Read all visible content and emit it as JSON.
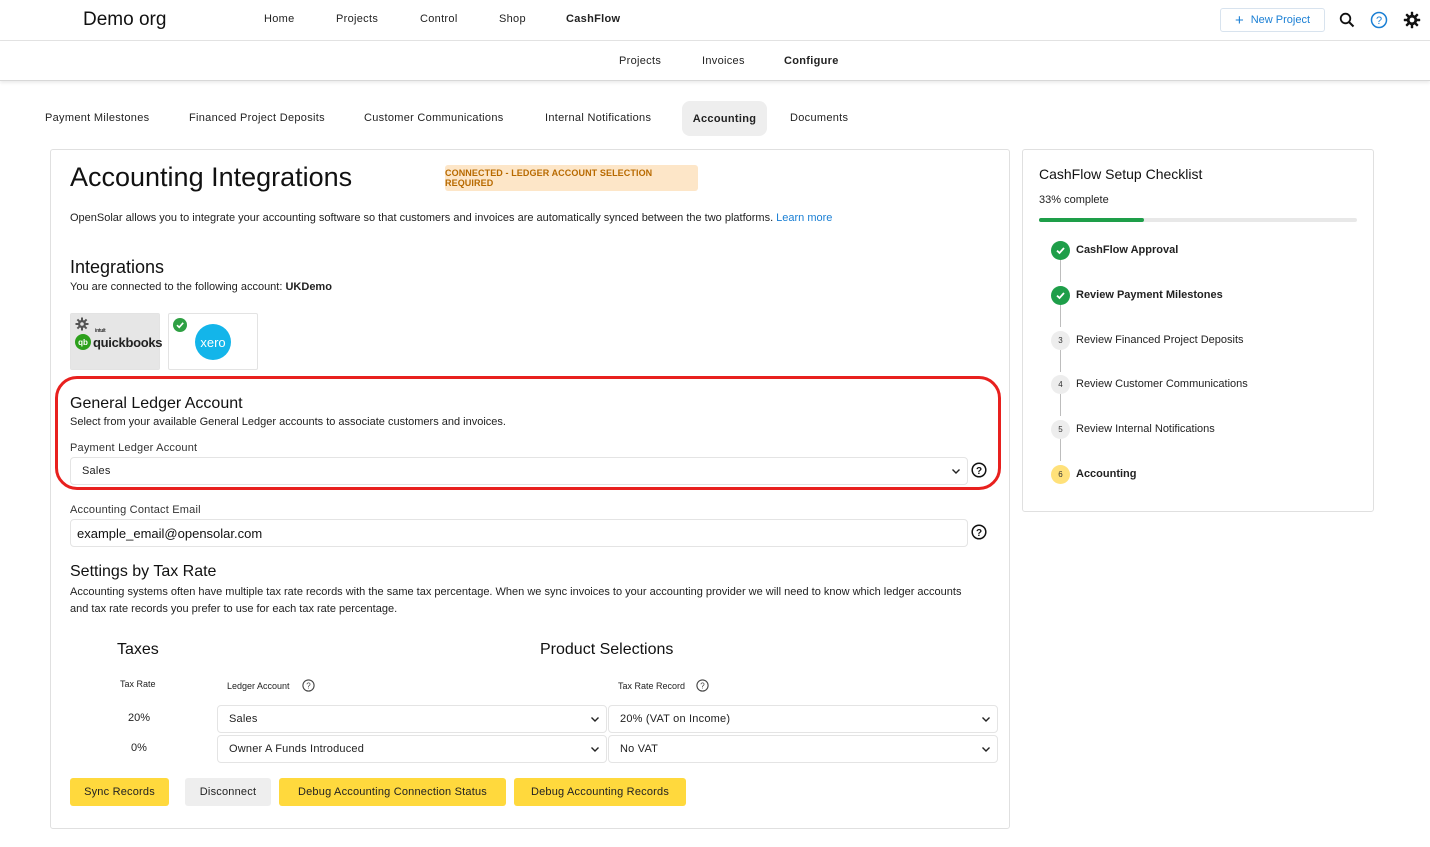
{
  "topbar": {
    "org_name": "Demo org",
    "nav": [
      "Home",
      "Projects",
      "Control",
      "Shop",
      "CashFlow"
    ],
    "new_project_label": "New Project",
    "icons": [
      "search-icon",
      "help-icon",
      "gear-icon"
    ]
  },
  "subnav": [
    "Projects",
    "Invoices",
    "Configure"
  ],
  "tabs": [
    "Payment Milestones",
    "Financed Project Deposits",
    "Customer Communications",
    "Internal Notifications",
    "Accounting",
    "Documents"
  ],
  "main": {
    "title": "Accounting Integrations",
    "status_badge": "CONNECTED - LEDGER ACCOUNT SELECTION REQUIRED",
    "intro": "OpenSolar allows you to integrate your accounting software so that customers and invoices are automatically synced between the two platforms.",
    "learn_more": "Learn more",
    "integrations_heading": "Integrations",
    "connected_prefix": "You are connected to the following account:",
    "connected_account": "UKDemo",
    "providers": {
      "quickbooks_intuit": "intuit",
      "quickbooks": "quickbooks",
      "xero": "xero"
    },
    "gl_heading": "General Ledger Account",
    "gl_desc": "Select from your available General Ledger accounts to associate customers and invoices.",
    "payment_ledger_label": "Payment Ledger Account",
    "payment_ledger_value": "Sales",
    "contact_email_label": "Accounting Contact Email",
    "contact_email_value": "example_email@opensolar.com",
    "tax_heading": "Settings by Tax Rate",
    "tax_desc": "Accounting systems often have multiple tax rate records with the same tax percentage. When we sync invoices to your accounting provider we will need to know which ledger accounts and tax rate records you prefer to use for each tax rate percentage.",
    "taxes_heading": "Taxes",
    "product_heading": "Product Selections",
    "col_tax_rate": "Tax Rate",
    "col_ledger": "Ledger Account",
    "col_tax_record": "Tax Rate Record",
    "rows": [
      {
        "rate": "20%",
        "ledger": "Sales",
        "record": "20% (VAT on Income)"
      },
      {
        "rate": "0%",
        "ledger": "Owner A Funds Introduced",
        "record": "No VAT"
      }
    ],
    "buttons": [
      "Sync Records",
      "Disconnect",
      "Debug Accounting Connection Status",
      "Debug Accounting Records"
    ]
  },
  "checklist": {
    "title": "CashFlow Setup Checklist",
    "progress_label": "33% complete",
    "progress": 0.33,
    "steps": [
      {
        "num": "",
        "label": "CashFlow Approval",
        "state": "done"
      },
      {
        "num": "",
        "label": "Review Payment Milestones",
        "state": "done"
      },
      {
        "num": "3",
        "label": "Review Financed Project Deposits",
        "state": "todo"
      },
      {
        "num": "4",
        "label": "Review Customer Communications",
        "state": "todo"
      },
      {
        "num": "5",
        "label": "Review Internal Notifications",
        "state": "todo"
      },
      {
        "num": "6",
        "label": "Accounting",
        "state": "current"
      }
    ]
  },
  "colors": {
    "accent": "#1a7fd4",
    "button_yellow": "#ffd93d",
    "success": "#1e9e49",
    "highlight": "#e8201e",
    "badge_bg": "#fde6c8",
    "badge_text": "#b86a00"
  }
}
